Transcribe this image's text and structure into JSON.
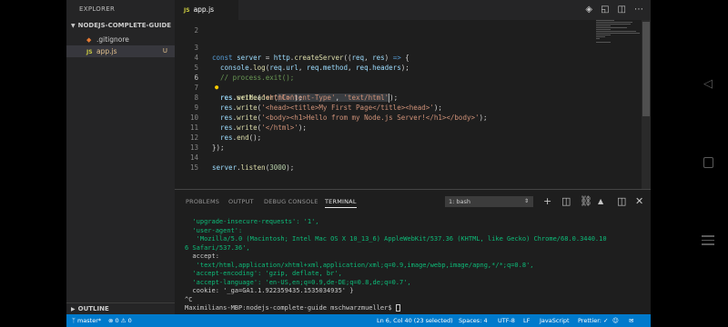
{
  "sidebar": {
    "title": "EXPLORER",
    "project": "NODEJS-COMPLETE-GUIDE",
    "files": [
      {
        "name": ".gitignore",
        "icon": "gitignore-icon"
      },
      {
        "name": "app.js",
        "icon": "js-file-icon",
        "badge": "U"
      }
    ],
    "outline_label": "OUTLINE"
  },
  "tabs": [
    {
      "label": "app.js",
      "icon": "js-file-icon",
      "active": true
    }
  ],
  "editor": {
    "lines": [
      {
        "num": "2",
        "text": ""
      },
      {
        "num": "3",
        "text": "const server = http.createServer((req, res) => {"
      },
      {
        "num": "4",
        "text": "  console.log(req.url, req.method, req.headers);"
      },
      {
        "num": "5",
        "text": "  // process.exit();"
      },
      {
        "num": "6",
        "text": "  res.setHeader('Content-Type', 'text/html');"
      },
      {
        "num": "7",
        "text": "  res.write('<html>');"
      },
      {
        "num": "8",
        "text": "  res.write('<head><title>My First Page</title></head>');"
      },
      {
        "num": "9",
        "text": "  res.write('<body><h1>Hello from my Node.js Server!</h1></body>');"
      },
      {
        "num": "10",
        "text": "  res.write('</html>');"
      },
      {
        "num": "11",
        "text": "  res.end();"
      },
      {
        "num": "12",
        "text": "});"
      },
      {
        "num": "13",
        "text": ""
      },
      {
        "num": "14",
        "text": "server.listen(3000);"
      },
      {
        "num": "15",
        "text": ""
      }
    ],
    "current_line": "6"
  },
  "panel": {
    "tabs": [
      "PROBLEMS",
      "OUTPUT",
      "DEBUG CONSOLE",
      "TERMINAL"
    ],
    "active_tab": "TERMINAL",
    "terminal_select": "1: bash",
    "terminal_lines": [
      "  'upgrade-insecure-requests': '1',",
      "  'user-agent':",
      "   'Mozilla/5.0 (Macintosh; Intel Mac OS X 10_13_6) AppleWebKit/537.36 (KHTML, like Gecko) Chrome/68.0.3440.10",
      "6 Safari/537.36',",
      "  accept:",
      "   'text/html,application/xhtml+xml,application/xml;q=0.9,image/webp,image/apng,*/*;q=0.8',",
      "  'accept-encoding': 'gzip, deflate, br',",
      "  'accept-language': 'en-US,en;q=0.9,de-DE;q=0.8,de;q=0.7',",
      "  cookie: '_ga=GA1.1.922359435.1535034935' }",
      "^C",
      "Maximilians-MBP:nodejs-complete-guide mschwarzmueller$ "
    ]
  },
  "status": {
    "branch": "master*",
    "errors": "0",
    "warnings": "0",
    "position": "Ln 6, Col 40 (23 selected)",
    "spaces": "Spaces: 4",
    "encoding": "UTF-8",
    "eol": "LF",
    "language": "JavaScript",
    "formatter": "Prettier: ✓"
  },
  "colors": {
    "status_bar": "#007acc",
    "editor_bg": "#1e1e1e",
    "sidebar_bg": "#252526",
    "modified_file": "#e2c08d"
  }
}
